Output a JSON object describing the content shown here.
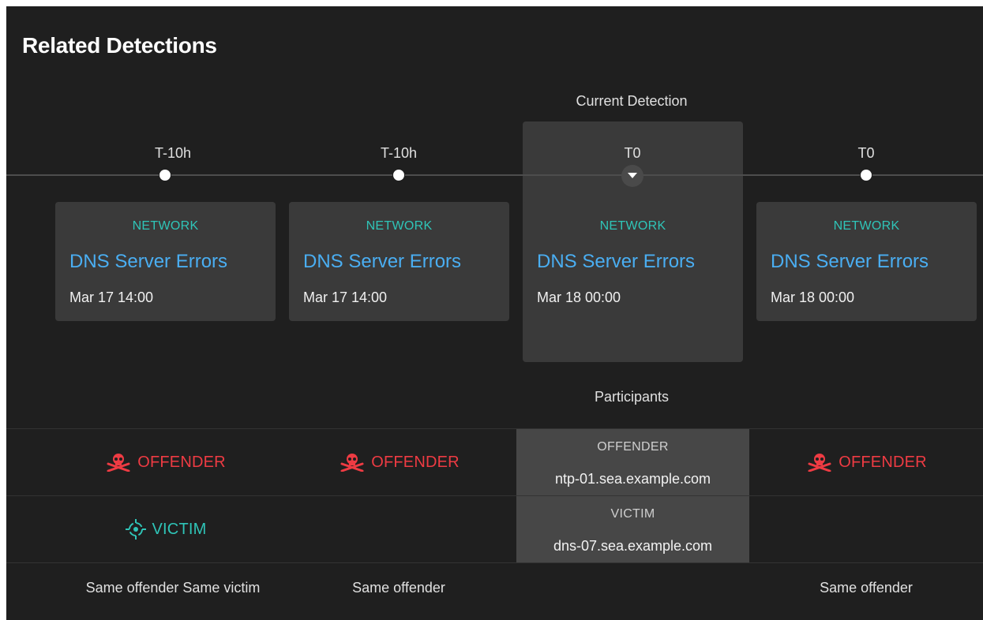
{
  "title": "Related Detections",
  "current_label": "Current Detection",
  "participants_label": "Participants",
  "columns": [
    {
      "time_label": "T-10h",
      "category": "NETWORK",
      "name": "DNS Server Errors",
      "date": "Mar 17 14:00",
      "offender": "OFFENDER",
      "victim": "VICTIM",
      "footer": "Same offender Same victim"
    },
    {
      "time_label": "T-10h",
      "category": "NETWORK",
      "name": "DNS Server Errors",
      "date": "Mar 17 14:00",
      "offender": "OFFENDER",
      "footer": "Same offender"
    },
    {
      "time_label": "T0",
      "category": "NETWORK",
      "name": "DNS Server Errors",
      "date": "Mar 18 00:00",
      "offender_heading": "OFFENDER",
      "offender_host": "ntp-01.sea.example.com",
      "victim_heading": "VICTIM",
      "victim_host": "dns-07.sea.example.com"
    },
    {
      "time_label": "T0",
      "category": "NETWORK",
      "name": "DNS Server Errors",
      "date": "Mar 18 00:00",
      "offender": "OFFENDER",
      "footer": "Same offender"
    }
  ],
  "icons": {
    "offender": "skull-crossbones-icon",
    "victim": "target-crosshair-icon",
    "current_marker": "caret-down-icon"
  },
  "colors": {
    "background": "#1f1f1f",
    "card": "#3a3a3a",
    "category": "#2fc5b8",
    "link": "#4aaef2",
    "offender": "#ee3b43",
    "victim": "#2fc5b8"
  }
}
